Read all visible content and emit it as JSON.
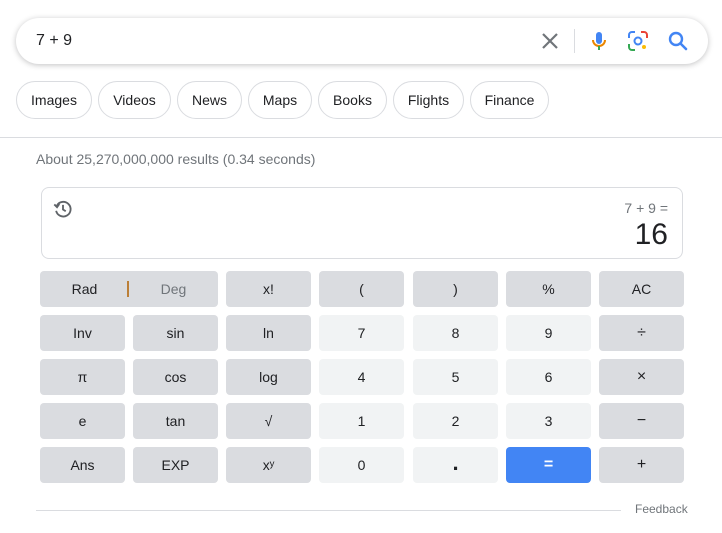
{
  "search": {
    "query": "7 + 9"
  },
  "icons": {
    "clear": "close-icon",
    "voice": "microphone-icon",
    "lens": "camera-lens-icon",
    "search": "search-icon",
    "history": "history-icon"
  },
  "chips": [
    "Images",
    "Videos",
    "News",
    "Maps",
    "Books",
    "Flights",
    "Finance"
  ],
  "stats": "About 25,270,000,000 results (0.34 seconds)",
  "calculator": {
    "expression": "7 + 9 =",
    "result": "16",
    "rad_label": "Rad",
    "deg_label": "Deg",
    "keys": {
      "fact": "x!",
      "lparen": "(",
      "rparen": ")",
      "percent": "%",
      "ac": "AC",
      "inv": "Inv",
      "sin": "sin",
      "ln": "ln",
      "seven": "7",
      "eight": "8",
      "nine": "9",
      "divide": "÷",
      "pi": "π",
      "cos": "cos",
      "log": "log",
      "four": "4",
      "five": "5",
      "six": "6",
      "multiply": "×",
      "e": "e",
      "tan": "tan",
      "sqrt": "√",
      "one": "1",
      "two": "2",
      "three": "3",
      "minus": "−",
      "ans": "Ans",
      "exp": "EXP",
      "power": "xʸ",
      "zero": "0",
      "dot": ".",
      "equals": "=",
      "plus": "+"
    }
  },
  "feedback": "Feedback",
  "colors": {
    "accent": "#4285f4",
    "key_fn": "#dadce0",
    "key_num": "#f1f3f4"
  }
}
